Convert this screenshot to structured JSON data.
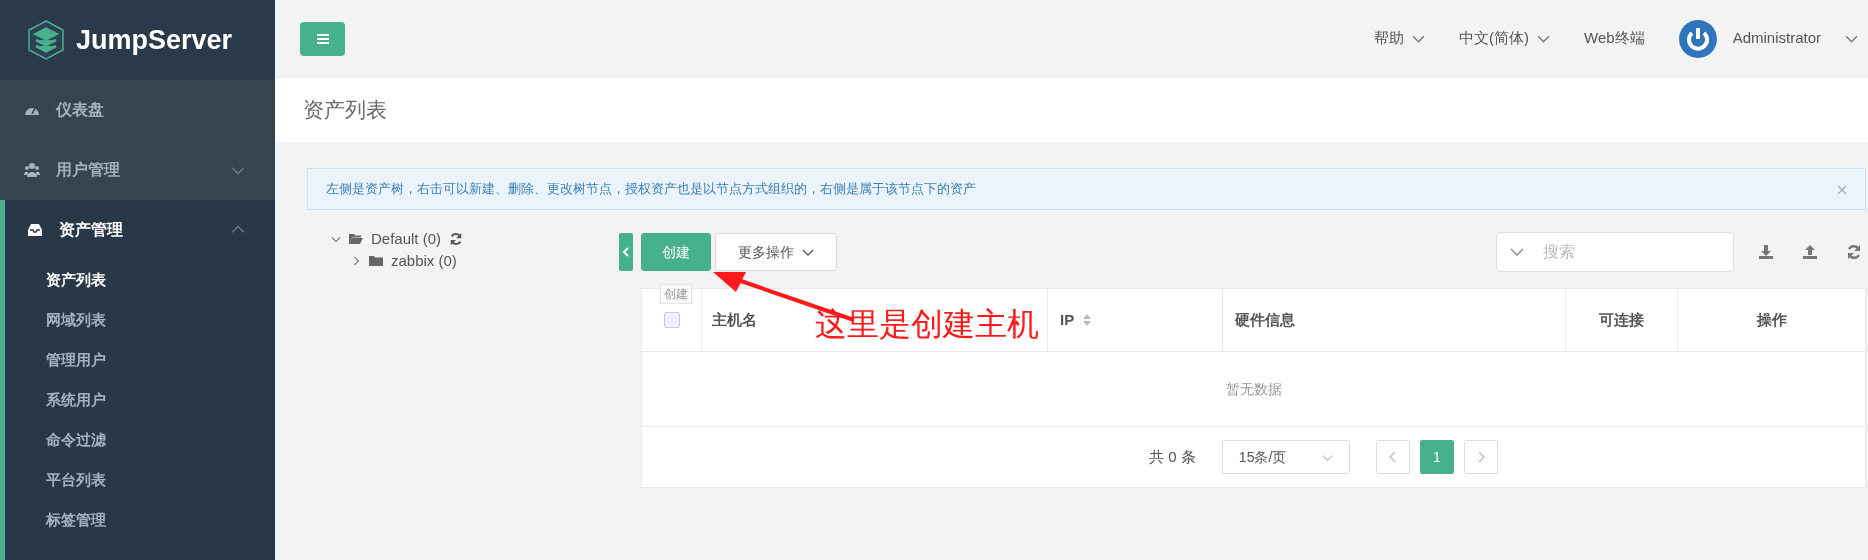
{
  "sidebar": {
    "brand": "JumpServer",
    "items": [
      {
        "label": "仪表盘",
        "kind": "link",
        "selected": false,
        "expanded": false
      },
      {
        "label": "用户管理",
        "kind": "group",
        "selected": false,
        "expanded": false
      },
      {
        "label": "资产管理",
        "kind": "group",
        "selected": true,
        "expanded": true,
        "children": [
          {
            "label": "资产列表",
            "selected": true
          },
          {
            "label": "网域列表",
            "selected": false
          },
          {
            "label": "管理用户",
            "selected": false
          },
          {
            "label": "系统用户",
            "selected": false
          },
          {
            "label": "命令过滤",
            "selected": false
          },
          {
            "label": "平台列表",
            "selected": false
          },
          {
            "label": "标签管理",
            "selected": false
          }
        ]
      }
    ]
  },
  "topbar": {
    "menus": [
      {
        "label": "帮助",
        "dropdown": true
      },
      {
        "label": "中文(简体)",
        "dropdown": true
      },
      {
        "label": "Web终端",
        "dropdown": false
      }
    ],
    "user": {
      "name": "Administrator"
    }
  },
  "page_title": "资产列表",
  "alert": {
    "text": "左侧是资产树，右击可以新建、删除、更改树节点，授权资产也是以节点方式组织的，右侧是属于该节点下的资产"
  },
  "tree": [
    {
      "label": "Default (0)",
      "expanded": true,
      "children": [
        {
          "label": "zabbix (0)",
          "expanded": false
        }
      ]
    }
  ],
  "toolbar": {
    "create": "创建",
    "tooltip": "创建",
    "more": "更多操作",
    "search_placeholder": "搜索"
  },
  "table": {
    "select_all_checked": false,
    "columns": [
      {
        "label": "主机名",
        "sortable": false
      },
      {
        "label": "IP",
        "sortable": true
      },
      {
        "label": "硬件信息",
        "sortable": false
      },
      {
        "label": "可连接",
        "sortable": false
      },
      {
        "label": "操作",
        "sortable": false
      }
    ],
    "empty_text": "暂无数据"
  },
  "pagination": {
    "total": "共 0 条",
    "page_size": "15条/页",
    "pages": [
      {
        "label": "1",
        "selected": true
      }
    ]
  },
  "annotation": {
    "text": "这里是创建主机"
  }
}
